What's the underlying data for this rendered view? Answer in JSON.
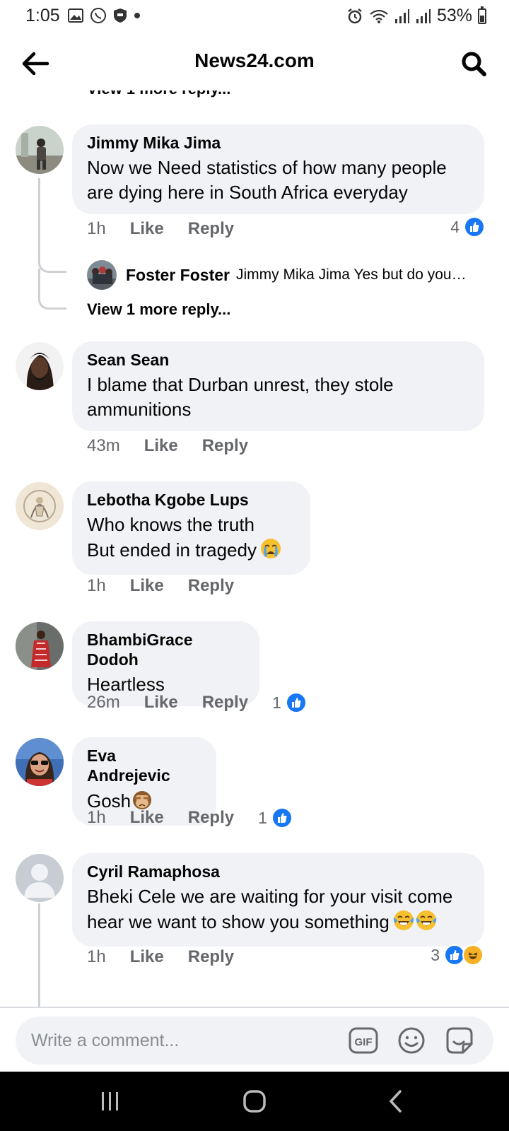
{
  "status": {
    "time": "1:05",
    "battery": "53%"
  },
  "header": {
    "title": "News24.com"
  },
  "top_partial_link": "View 1 more reply...",
  "comments": [
    {
      "author": "Jimmy Mika Jima",
      "text_lines": [
        "Now we Need statistics of how many people",
        "are dying here in South Africa everyday"
      ],
      "time": "1h",
      "like": "Like",
      "reply": "Reply",
      "reaction_count": "4",
      "reply_preview": {
        "author": "Foster Foster",
        "text": "Jimmy Mika Jima Yes but do you…"
      },
      "more_replies": "View 1 more reply..."
    },
    {
      "author": "Sean Sean",
      "text_lines": [
        "I blame that Durban unrest, they stole",
        "ammunitions"
      ],
      "time": "43m",
      "like": "Like",
      "reply": "Reply"
    },
    {
      "author": "Lebotha Kgobe Lups",
      "text_lines": [
        "Who knows the truth",
        "But ended in tragedy"
      ],
      "time": "1h",
      "like": "Like",
      "reply": "Reply"
    },
    {
      "author": "BhambiGrace Dodoh",
      "text_lines": [
        "Heartless"
      ],
      "time": "26m",
      "like": "Like",
      "reply": "Reply",
      "reaction_count": "1"
    },
    {
      "author": "Eva Andrejevic",
      "text_lines": [
        "Gosh"
      ],
      "time": "1h",
      "like": "Like",
      "reply": "Reply",
      "reaction_count": "1"
    },
    {
      "author": "Cyril Ramaphosa",
      "text_lines": [
        "Bheki Cele we are waiting for your visit come",
        "hear we want to show you something"
      ],
      "time": "1h",
      "like": "Like",
      "reply": "Reply",
      "reaction_count": "3"
    }
  ],
  "composer": {
    "placeholder": "Write a comment...",
    "gif_label": "GIF"
  },
  "icons": {
    "back": "arrow-left-icon",
    "search": "search-icon",
    "like": "like-reaction-icon",
    "haha": "haha-reaction-icon",
    "gif": "gif-icon",
    "emoji": "emoji-icon",
    "sticker": "sticker-icon"
  },
  "colors": {
    "accent": "#1877f2",
    "bubble": "#f0f2f5",
    "meta_text": "#65676b"
  }
}
